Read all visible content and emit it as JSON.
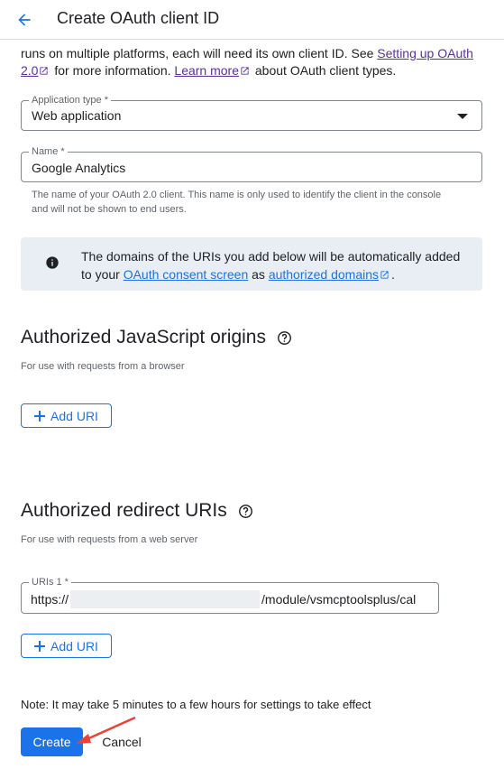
{
  "header": {
    "title": "Create OAuth client ID",
    "back_icon": "arrow-back-icon"
  },
  "intro": {
    "text_before": "runs on multiple platforms, each will need its own client ID. See ",
    "setup_link": "Setting up OAuth 2.0",
    "text_middle": " for more information. ",
    "learn_more_link": "Learn more",
    "text_after": " about OAuth client types."
  },
  "application_type": {
    "label": "Application type *",
    "value": "Web application"
  },
  "name_field": {
    "label": "Name *",
    "value": "Google Analytics",
    "helper": "The name of your OAuth 2.0 client. This name is only used to identify the client in the console and will not be shown to end users."
  },
  "info_box": {
    "text_before": "The domains of the URIs you add below will be automatically added to your ",
    "consent_link": "OAuth consent screen",
    "text_middle": " as ",
    "domains_link": "authorized domains",
    "text_after": "."
  },
  "js_origins": {
    "title": "Authorized JavaScript origins",
    "subtitle": "For use with requests from a browser",
    "add_button": "Add URI"
  },
  "redirect_uris": {
    "title": "Authorized redirect URIs",
    "subtitle": "For use with requests from a web server",
    "uri_label": "URIs 1 *",
    "uri_prefix": "https://",
    "uri_suffix": "/module/vsmcptoolsplus/cal",
    "add_button": "Add URI"
  },
  "footer": {
    "note": "Note: It may take 5 minutes to a few hours for settings to take effect",
    "create_button": "Create",
    "cancel_button": "Cancel"
  },
  "colors": {
    "accent": "#1a73e8",
    "visited_link": "#5a2fa0",
    "info_bg": "#e8eef4",
    "annotation_arrow": "#ea4335"
  }
}
